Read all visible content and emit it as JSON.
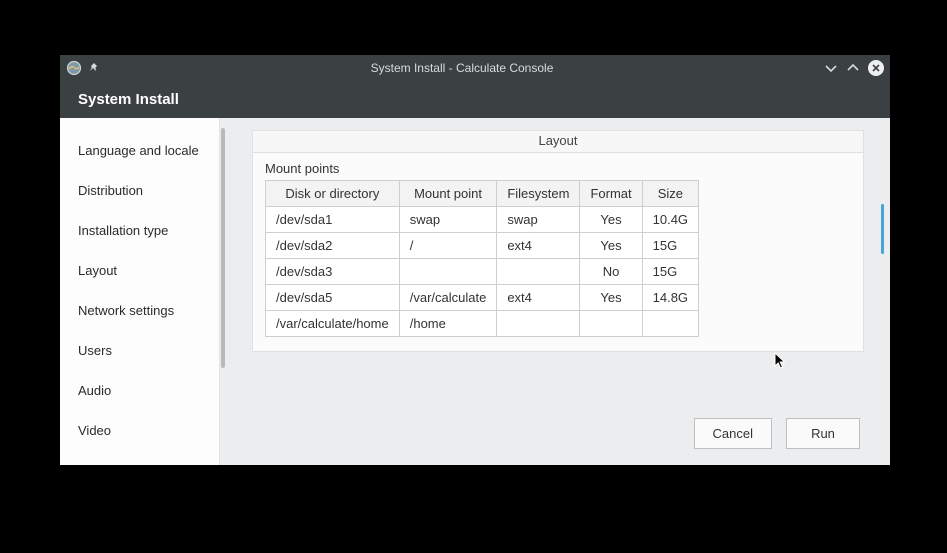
{
  "window": {
    "title": "System Install - Calculate Console"
  },
  "header": {
    "title": "System Install"
  },
  "sidebar": {
    "items": [
      {
        "label": "Language and locale"
      },
      {
        "label": "Distribution"
      },
      {
        "label": "Installation type"
      },
      {
        "label": "Layout"
      },
      {
        "label": "Network settings"
      },
      {
        "label": "Users"
      },
      {
        "label": "Audio"
      },
      {
        "label": "Video"
      }
    ]
  },
  "panel": {
    "title": "Layout",
    "section_label": "Mount points",
    "columns": {
      "c0": "Disk or directory",
      "c1": "Mount point",
      "c2": "Filesystem",
      "c3": "Format",
      "c4": "Size"
    },
    "rows": [
      {
        "disk": "/dev/sda1",
        "mount": "swap",
        "fs": "swap",
        "format": "Yes",
        "size": "10.4G"
      },
      {
        "disk": "/dev/sda2",
        "mount": "/",
        "fs": "ext4",
        "format": "Yes",
        "size": "15G"
      },
      {
        "disk": "/dev/sda3",
        "mount": "",
        "fs": "",
        "format": "No",
        "size": "15G"
      },
      {
        "disk": "/dev/sda5",
        "mount": "/var/calculate",
        "fs": "ext4",
        "format": "Yes",
        "size": "14.8G"
      },
      {
        "disk": "/var/calculate/home",
        "mount": "/home",
        "fs": "",
        "format": "",
        "size": ""
      }
    ]
  },
  "buttons": {
    "cancel": "Cancel",
    "run": "Run"
  }
}
